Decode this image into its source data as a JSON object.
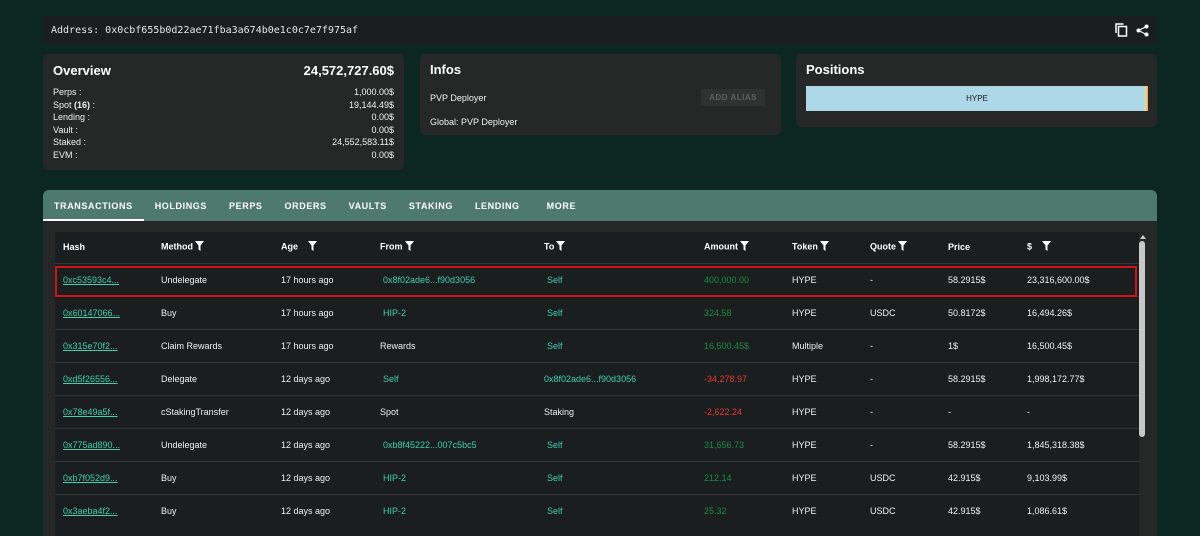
{
  "address": {
    "label": "Address: 0x0cbf655b0d22ae71fba3a674b0e1c0c7e7f975af"
  },
  "overview": {
    "title": "Overview",
    "total": "24,572,727.60$",
    "rows": [
      {
        "label": "Perps :",
        "value": "1,000.00$"
      },
      {
        "label": "Spot",
        "badge": "(16)",
        "suffix": " :",
        "value": "19,144.49$"
      },
      {
        "label": "Lending :",
        "value": "0.00$"
      },
      {
        "label": "Vault :",
        "value": "0.00$"
      },
      {
        "label": "Staked :",
        "value": "24,552,583.11$"
      },
      {
        "label": "EVM :",
        "value": "0.00$"
      }
    ]
  },
  "infos": {
    "title": "Infos",
    "name": "PVP Deployer",
    "add_alias": "ADD ALIAS",
    "global": "Global: PVP Deployer"
  },
  "positions": {
    "title": "Positions",
    "bar_label": "HYPE"
  },
  "tabs": [
    "TRANSACTIONS",
    "HOLDINGS",
    "PERPS",
    "ORDERS",
    "VAULTS",
    "STAKING",
    "LENDING",
    "MORE"
  ],
  "table": {
    "headers": [
      "Hash",
      "Method",
      "Age",
      "From",
      "To",
      "Amount",
      "Token",
      "Quote",
      "Price",
      "$"
    ],
    "rows": [
      [
        "0xc53593c4...",
        "Undelegate",
        "17 hours ago",
        "0x8f02ade6...f90d3056",
        "Self",
        "400,000.00",
        "HYPE",
        "-",
        "58.2915$",
        "23,316,600.00$"
      ],
      [
        "0x60147066...",
        "Buy",
        "17 hours ago",
        "HIP-2",
        "Self",
        "324.58",
        "HYPE",
        "USDC",
        "50.8172$",
        "16,494.26$"
      ],
      [
        "0x315e70f2...",
        "Claim Rewards",
        "17 hours ago",
        "Rewards",
        "Self",
        "16,500.45$",
        "Multiple",
        "-",
        "1$",
        "16,500.45$"
      ],
      [
        "0xd5f26556...",
        "Delegate",
        "12 days ago",
        "Self",
        "0x8f02ade6...f90d3056",
        "-34,278.97",
        "HYPE",
        "-",
        "58.2915$",
        "1,998,172.77$"
      ],
      [
        "0x78e49a5f...",
        "cStakingTransfer",
        "12 days ago",
        "Spot",
        "Staking",
        "-2,622.24",
        "HYPE",
        "-",
        "-",
        "-"
      ],
      [
        "0x775ad890...",
        "Undelegate",
        "12 days ago",
        "0xb8f45222...007c5bc5",
        "Self",
        "31,656.73",
        "HYPE",
        "-",
        "58.2915$",
        "1,845,318.38$"
      ],
      [
        "0xb7f052d9...",
        "Buy",
        "12 days ago",
        "HIP-2",
        "Self",
        "212.14",
        "HYPE",
        "USDC",
        "42.915$",
        "9,103.99$"
      ],
      [
        "0x3aeba4f2...",
        "Buy",
        "12 days ago",
        "HIP-2",
        "Self",
        "25.32",
        "HYPE",
        "USDC",
        "42.915$",
        "1,086.61$"
      ]
    ],
    "from_style": [
      "teal",
      "teal",
      "plain",
      "teal",
      "plain",
      "teal",
      "teal",
      "teal"
    ],
    "to_style": [
      "teal",
      "teal",
      "teal",
      "teal",
      "plain",
      "teal",
      "teal",
      "teal"
    ],
    "amount_style": [
      "green",
      "green",
      "green",
      "red",
      "red",
      "green",
      "green",
      "green"
    ]
  },
  "colors": {
    "accent": "#3ecfb4",
    "tab_bar": "#4e7a6d",
    "positive": "#1a8c4a",
    "negative": "#e53935",
    "highlight": "#d0121b"
  }
}
